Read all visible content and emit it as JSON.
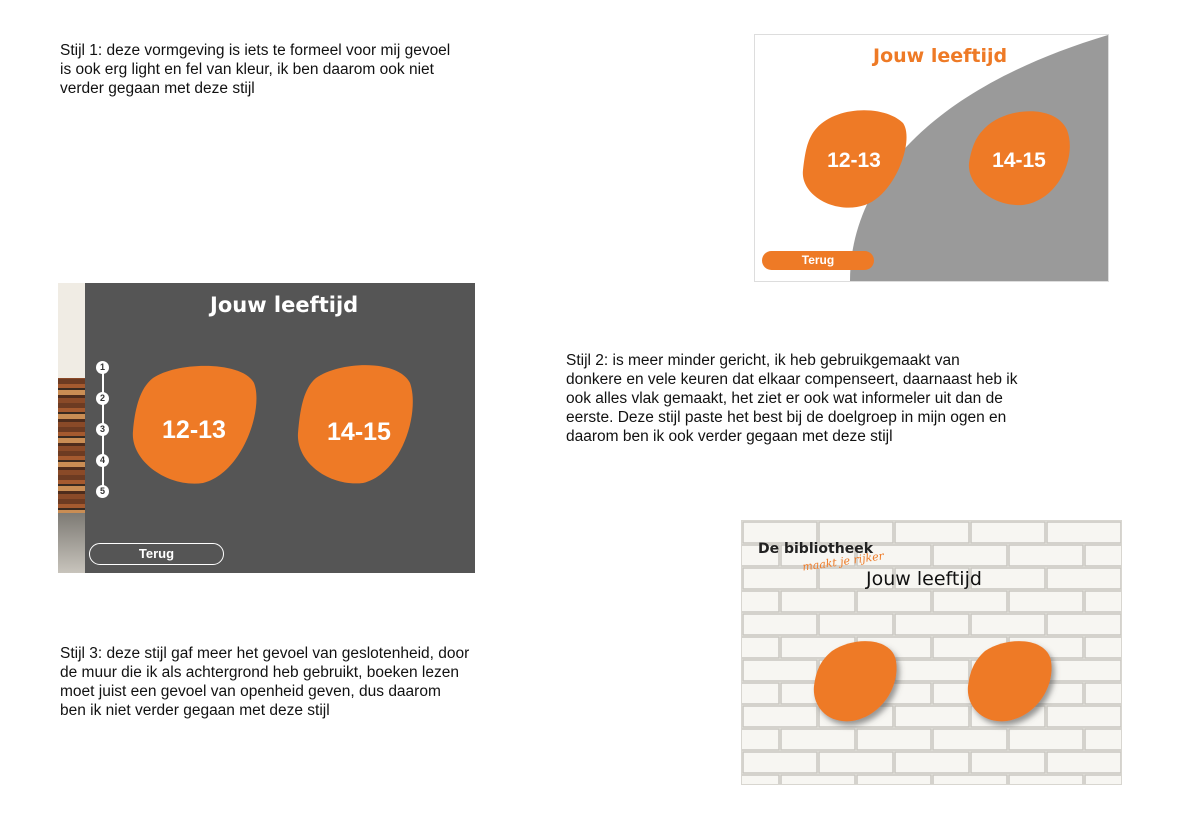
{
  "notes": {
    "style1": [
      "Stijl 1: deze vormgeving is iets te formeel voor mij gevoel",
      "is ook erg light en fel van kleur, ik ben daarom ook niet",
      "verder gegaan met deze stijl"
    ],
    "style2": [
      "Stijl 2: is meer minder gericht, ik heb gebruikgemaakt van",
      "donkere en vele keuren dat elkaar compenseert, daarnaast heb ik",
      "ook alles vlak gemaakt, het ziet er ook wat informeler uit dan de",
      "eerste. Deze stijl paste het best bij de doelgroep in mijn ogen en",
      "daarom ben ik ook verder gegaan met deze stijl"
    ],
    "style3": [
      "Stijl 3: deze stijl gaf meer het gevoel van geslotenheid, door",
      "de muur die ik als achtergrond heb gebruikt, boeken lezen",
      "moet juist een gevoel van openheid geven, dus daarom",
      "ben ik niet verder gegaan met deze stijl"
    ]
  },
  "mockup1": {
    "title": "Jouw leeftijd",
    "option_a": "12-13",
    "option_b": "14-15",
    "back": "Terug"
  },
  "mockup2": {
    "title": "Jouw leeftijd",
    "option_a": "12-13",
    "option_b": "14-15",
    "back": "Terug",
    "steps": [
      "1",
      "2",
      "3",
      "4",
      "5"
    ]
  },
  "mockup3": {
    "brand": "De bibliotheek",
    "tagline": "maakt je rijker",
    "title": "Jouw leeftijd"
  },
  "colors": {
    "accent": "#ee7a26",
    "dark_bg": "#555555",
    "gray_shape": "#9a9a9a",
    "wall": "#f1f0ec"
  }
}
